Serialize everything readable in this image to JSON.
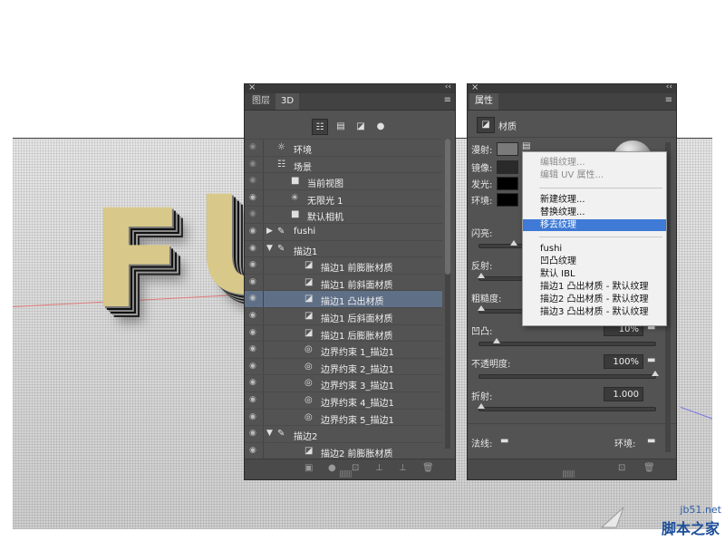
{
  "layers_panel": {
    "tabs": [
      "图层",
      "3D"
    ],
    "close": "×",
    "collapse": "‹‹",
    "menu": "≡",
    "filter_icons": [
      "scene-list-icon",
      "mesh-icon",
      "material-icon",
      "light-icon"
    ],
    "rows": [
      {
        "label": "环境",
        "icon": "☼",
        "indent": 0,
        "expand": "",
        "eye": "dim",
        "selected": false
      },
      {
        "label": "场景",
        "icon": "☷",
        "indent": 0,
        "expand": "",
        "eye": "dim",
        "selected": false
      },
      {
        "label": "当前视图",
        "icon": "■",
        "indent": 1,
        "expand": "",
        "eye": "dim",
        "selected": false
      },
      {
        "label": "无限光 1",
        "icon": "✳",
        "indent": 1,
        "expand": "",
        "eye": "on",
        "selected": false
      },
      {
        "label": "默认相机",
        "icon": "■",
        "indent": 1,
        "expand": "",
        "eye": "dim",
        "selected": false
      },
      {
        "label": "fushi",
        "icon": "✎",
        "indent": 0,
        "expand": "▶",
        "eye": "on",
        "selected": false
      },
      {
        "label": "描边1",
        "icon": "✎",
        "indent": 0,
        "expand": "▼",
        "eye": "on",
        "selected": false
      },
      {
        "label": "描边1 前膨胀材质",
        "icon": "◪",
        "indent": 2,
        "expand": "",
        "eye": "on",
        "selected": false
      },
      {
        "label": "描边1 前斜面材质",
        "icon": "◪",
        "indent": 2,
        "expand": "",
        "eye": "on",
        "selected": false
      },
      {
        "label": "描边1 凸出材质",
        "icon": "◪",
        "indent": 2,
        "expand": "",
        "eye": "on",
        "selected": true
      },
      {
        "label": "描边1 后斜面材质",
        "icon": "◪",
        "indent": 2,
        "expand": "",
        "eye": "on",
        "selected": false
      },
      {
        "label": "描边1 后膨胀材质",
        "icon": "◪",
        "indent": 2,
        "expand": "",
        "eye": "on",
        "selected": false
      },
      {
        "label": "边界约束 1_描边1",
        "icon": "◎",
        "indent": 2,
        "expand": "",
        "eye": "on",
        "selected": false
      },
      {
        "label": "边界约束 2_描边1",
        "icon": "◎",
        "indent": 2,
        "expand": "",
        "eye": "on",
        "selected": false
      },
      {
        "label": "边界约束 3_描边1",
        "icon": "◎",
        "indent": 2,
        "expand": "",
        "eye": "on",
        "selected": false
      },
      {
        "label": "边界约束 4_描边1",
        "icon": "◎",
        "indent": 2,
        "expand": "",
        "eye": "on",
        "selected": false
      },
      {
        "label": "边界约束 5_描边1",
        "icon": "◎",
        "indent": 2,
        "expand": "",
        "eye": "on",
        "selected": false
      },
      {
        "label": "描边2",
        "icon": "✎",
        "indent": 0,
        "expand": "▼",
        "eye": "on",
        "selected": false
      },
      {
        "label": "描边2 前膨胀材质",
        "icon": "◪",
        "indent": 2,
        "expand": "",
        "eye": "on",
        "selected": false
      }
    ],
    "bottom_icons": [
      "▣",
      "●",
      "⊡",
      "⊥",
      "⊥",
      "🗑"
    ]
  },
  "properties_panel": {
    "tab": "属性",
    "close": "×",
    "collapse": "‹‹",
    "menu": "≡",
    "section_title": "材质",
    "diffuse_label": "漫射:",
    "specular_label": "镜像:",
    "emissive_label": "发光:",
    "ambient_label": "环境:",
    "shine_label": "闪亮:",
    "reflection_label": "反射:",
    "roughness_label": "粗糙度:",
    "bump_label": "凹凸:",
    "bump_value": "10%",
    "bump_level": 0.1,
    "opacity_label": "不透明度:",
    "opacity_value": "100%",
    "opacity_level": 1.0,
    "refraction_label": "折射:",
    "refraction_value": "1.000",
    "normal_label": "法线:",
    "environment_label": "环境:",
    "colors": {
      "diffuse": "#7a7a7a",
      "specular": "#2a2a2a",
      "emissive": "#000000",
      "ambient": "#000000"
    }
  },
  "context_menu": {
    "items_group1": [
      "编辑纹理...",
      "编辑 UV 属性..."
    ],
    "items_group2": [
      "新建纹理...",
      "替换纹理...",
      "移去纹理"
    ],
    "highlighted": "移去纹理",
    "items_group3": [
      "fushi",
      "凹凸纹理",
      "默认 IBL",
      "描边1 凸出材质 - 默认纹理",
      "描边2 凸出材质 - 默认纹理",
      "描边3 凸出材质 - 默认纹理"
    ]
  },
  "scene": {
    "letters": [
      "F",
      "U"
    ]
  },
  "watermark": {
    "site": "jb51.net",
    "name": "脚本之家"
  }
}
